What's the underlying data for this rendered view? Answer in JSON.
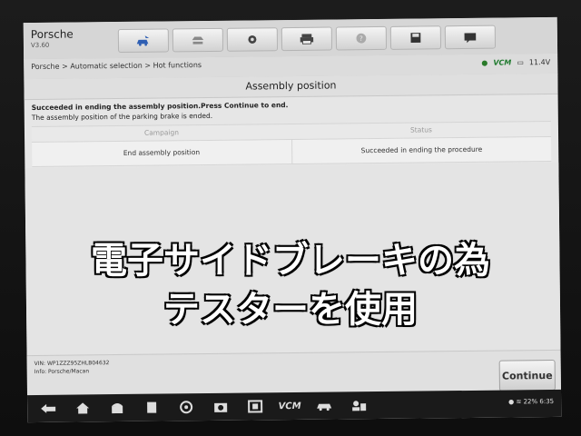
{
  "app": {
    "name": "Porsche",
    "version": "V3.60"
  },
  "toolbar": {
    "buttons": [
      "home-vehicle-icon",
      "vehicle-lift-icon",
      "gear-icon",
      "printer-icon",
      "help-icon",
      "save-icon",
      "message-icon"
    ]
  },
  "breadcrumb": "Porsche > Automatic selection > Hot functions",
  "status_bar": {
    "vcm": "VCM",
    "voltage": "11.4V"
  },
  "page": {
    "title": "Assembly position",
    "message_line1": "Succeeded in ending the assembly position.Press Continue to end.",
    "message_line2": "The assembly position of the parking brake is ended."
  },
  "table": {
    "headers": [
      "Campaign",
      "Status"
    ],
    "rows": [
      {
        "campaign": "End assembly position",
        "status": "Succeeded in ending the procedure"
      }
    ]
  },
  "footer": {
    "vin": "VIN: WP1ZZZ95ZHLB04632",
    "info": "Info: Porsche/Macan",
    "continue_label": "Continue"
  },
  "android": {
    "battery": "22%",
    "time": "6:35",
    "vcm": "VCM"
  },
  "overlay": {
    "line1": "電子サイドブレーキの為",
    "line2": "テスターを使用"
  },
  "colors": {
    "accent": "#1f7a2e",
    "overlay_text": "#ffffff"
  }
}
